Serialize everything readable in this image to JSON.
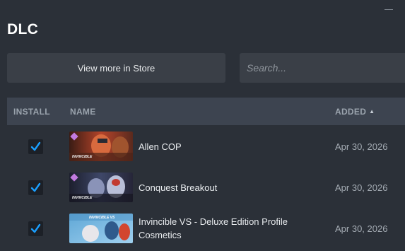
{
  "page": {
    "title": "DLC"
  },
  "toolbar": {
    "store_label": "View more in Store",
    "search_placeholder": "Search..."
  },
  "table": {
    "columns": {
      "install": "INSTALL",
      "name": "NAME",
      "added": "ADDED"
    },
    "sort_icon": "caret-up-icon",
    "rows": [
      {
        "installed": true,
        "name": "Allen COP",
        "date": "Apr 30, 2026",
        "thumb_label": "INVINCIBLE"
      },
      {
        "installed": true,
        "name": "Conquest Breakout",
        "date": "Apr 30, 2026",
        "thumb_label": "INVINCIBLE"
      },
      {
        "installed": true,
        "name": "Invincible VS - Deluxe Edition Profile Cosmetics",
        "date": "Apr 30, 2026",
        "thumb_label": "INVINCIBLE VS"
      }
    ]
  },
  "colors": {
    "background": "#2b3038",
    "button": "#3a3f47",
    "header": "#3d4450",
    "checkmark": "#1a9fff",
    "badge": "#c27be0"
  }
}
